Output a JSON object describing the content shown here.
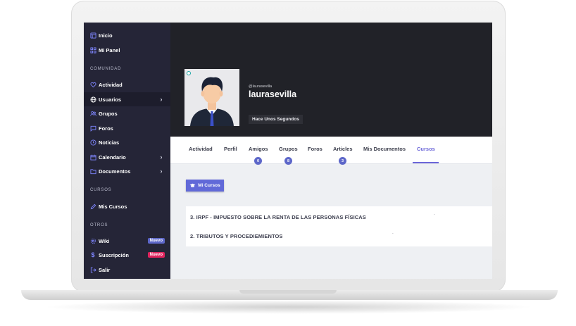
{
  "colors": {
    "sidebar": "#252537",
    "accent": "#6b66d8",
    "badge_nuevo_wiki": "#5d67c9",
    "badge_nuevo_suscripcion": "#e0245e"
  },
  "sidebar": {
    "items_top": [
      {
        "label": "Inicio",
        "icon": "layout-icon"
      },
      {
        "label": "Mi Panel",
        "icon": "grid-icon"
      }
    ],
    "section_comunidad": "COMUNIDAD",
    "items_comunidad": [
      {
        "label": "Actividad",
        "icon": "heart-icon"
      },
      {
        "label": "Usuarios",
        "icon": "globe-icon"
      },
      {
        "label": "Grupos",
        "icon": "users-icon"
      },
      {
        "label": "Foros",
        "icon": "chat-icon"
      },
      {
        "label": "Noticias",
        "icon": "clock-icon"
      },
      {
        "label": "Calendario",
        "icon": "calendar-icon"
      },
      {
        "label": "Documentos",
        "icon": "folder-icon"
      }
    ],
    "section_cursos": "CURSOS",
    "items_cursos": [
      {
        "label": "Mis Cursos",
        "icon": "pen-icon"
      }
    ],
    "section_otros": "OTROS",
    "items_otros": [
      {
        "label": "Wiki",
        "icon": "gear-icon",
        "badge": "Nuevo"
      },
      {
        "label": "Suscripción",
        "icon": "dollar-icon",
        "badge": "Nuevo"
      },
      {
        "label": "Salir",
        "icon": "logout-icon"
      }
    ]
  },
  "profile": {
    "handle": "@laurasevilla",
    "username": "laurasevilla",
    "last_seen": "Hace Unos Segundos"
  },
  "tabs": [
    {
      "label": "Actividad"
    },
    {
      "label": "Perfil"
    },
    {
      "label": "Amigos",
      "count": "0"
    },
    {
      "label": "Grupos",
      "count": "8"
    },
    {
      "label": "Foros"
    },
    {
      "label": "Articles",
      "count": "3"
    },
    {
      "label": "Mis Documentos"
    },
    {
      "label": "Cursos",
      "active": true
    }
  ],
  "cursos_button": "Mi Cursos",
  "courses": [
    {
      "title": "3. IRPF - IMPUESTO SOBRE LA RENTA DE LAS PERSONAS FÍSICAS",
      "mark": "-"
    },
    {
      "title": "2. TRIBUTOS Y PROCEDIEMIENTOS",
      "mark": "-"
    }
  ]
}
